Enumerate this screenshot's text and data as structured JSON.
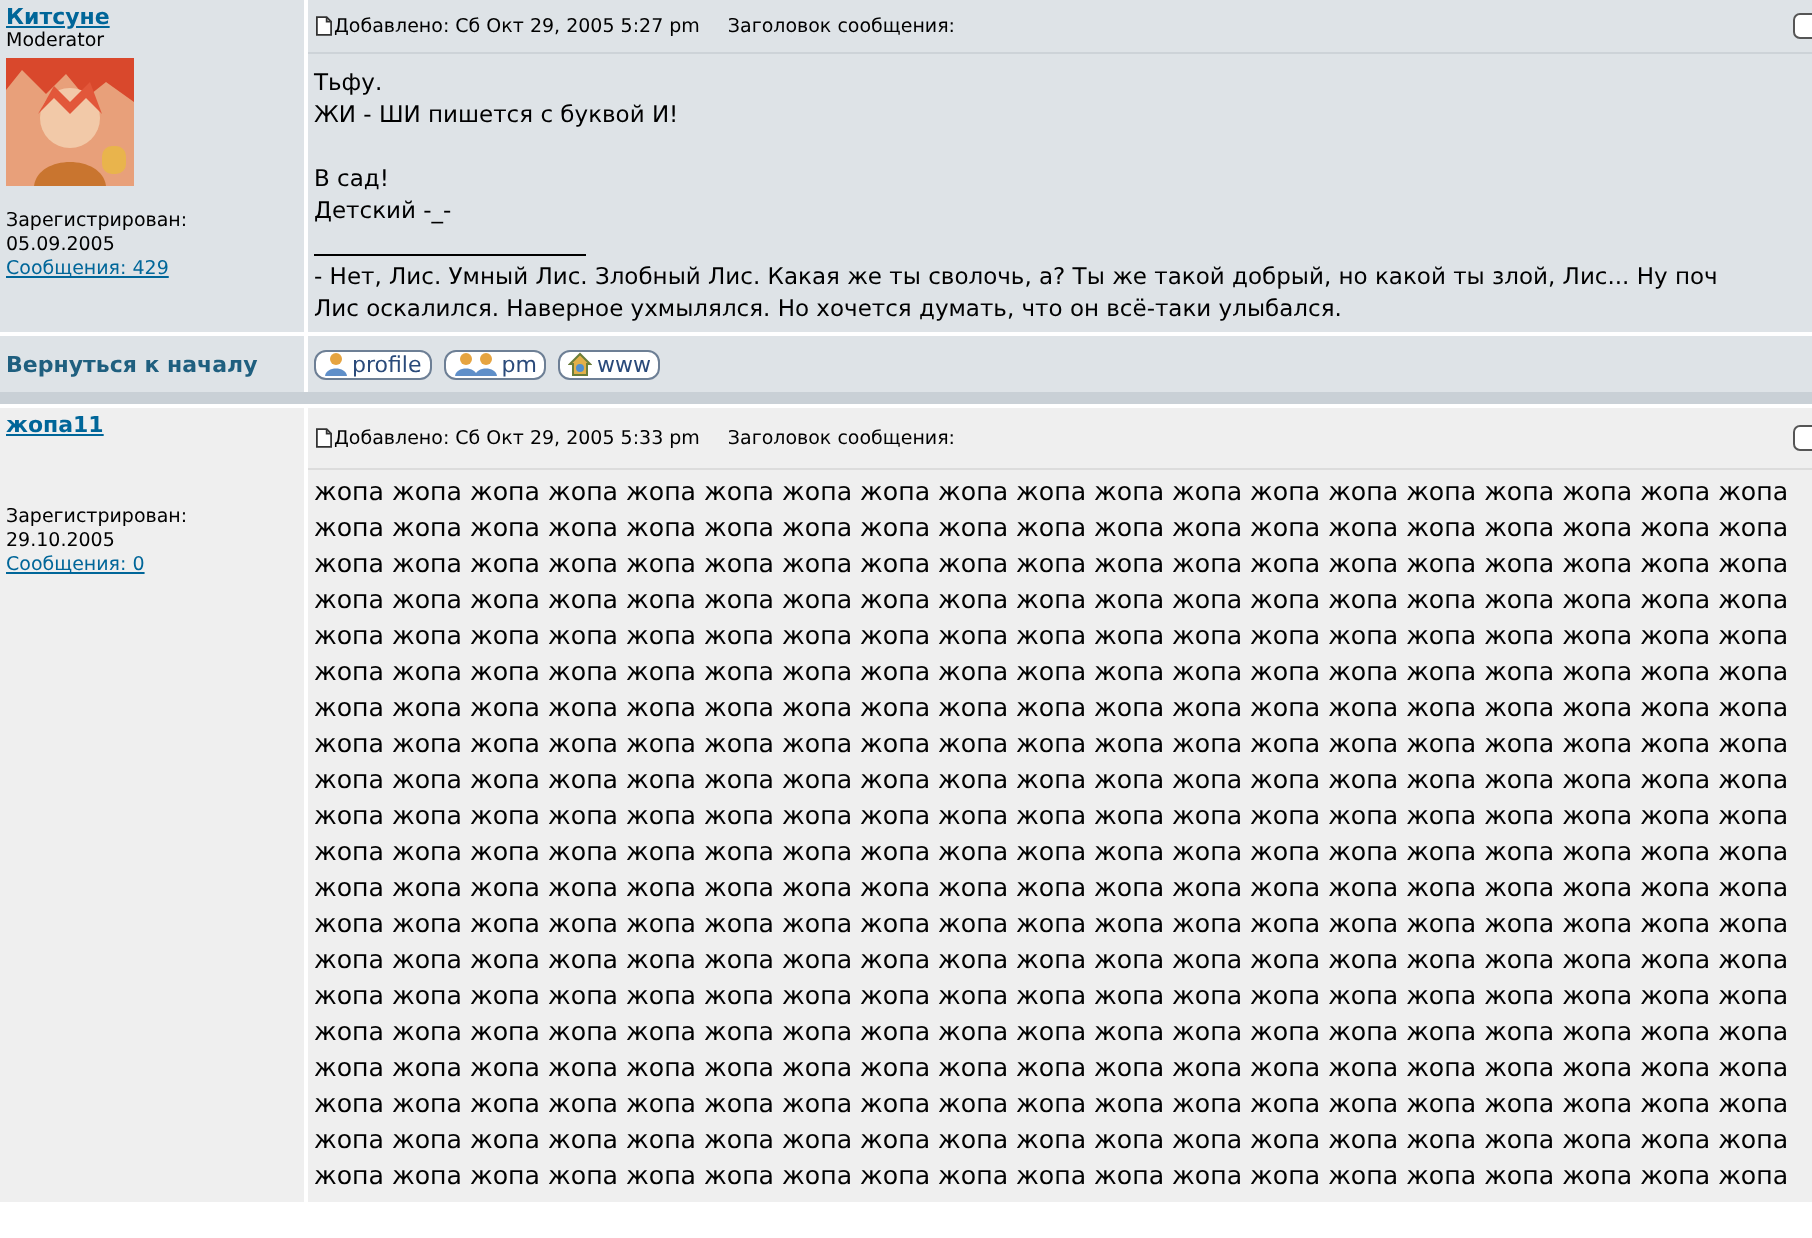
{
  "posts": [
    {
      "author": "Китсуне",
      "rank": "Moderator",
      "avatar": {
        "kind": "picture"
      },
      "registered_label": "Зарегистрирован:",
      "registered_date": "05.09.2005",
      "messages_link": "Сообщения: 429",
      "posted": "Добавлено: Сб Окт 29, 2005 5:27 pm",
      "subject_label": "Заголовок сообщения:",
      "paragraphs": [
        [
          "Тьфу.",
          "ЖИ - ШИ пишется с буквой И!"
        ],
        [
          "В сад!",
          "Детский -_-"
        ]
      ],
      "signature": [
        "- Нет, Лис. Умный Лис. Злобный Лис. Какая же ты сволочь, а? Ты же такой добрый, но какой ты злой, Лис... Ну поч",
        "Лис оскалился. Наверное ухмылялся. Но хочется думать, что он всё-таки улыбался."
      ],
      "back_link": "Вернуться к началу",
      "buttons": [
        {
          "label": "profile",
          "kind": "person"
        },
        {
          "label": "pm",
          "kind": "people"
        },
        {
          "label": "www",
          "kind": "home"
        }
      ]
    },
    {
      "author": "жопа11",
      "registered_label": "Зарегистрирован:",
      "registered_date": "29.10.2005",
      "messages_link": "Сообщения: 0",
      "posted": "Добавлено: Сб Окт 29, 2005 5:33 pm",
      "subject_label": "Заголовок сообщения:",
      "paragraphs": [
        [
          "жопа жопа жопа жопа жопа жопа жопа жопа жопа жопа жопа жопа жопа жопа жопа жопа жопа жопа жопа",
          "жопа жопа жопа жопа жопа жопа жопа жопа жопа жопа жопа жопа жопа жопа жопа жопа жопа жопа жопа",
          "жопа жопа жопа жопа жопа жопа жопа жопа жопа жопа жопа жопа жопа жопа жопа жопа жопа жопа жопа",
          "жопа жопа жопа жопа жопа жопа жопа жопа жопа жопа жопа жопа жопа жопа жопа жопа жопа жопа жопа",
          "жопа жопа жопа жопа жопа жопа жопа жопа жопа жопа жопа жопа жопа жопа жопа жопа жопа жопа жопа",
          "жопа жопа жопа жопа жопа жопа жопа жопа жопа жопа жопа жопа жопа жопа жопа жопа жопа жопа жопа",
          "жопа жопа жопа жопа жопа жопа жопа жопа жопа жопа жопа жопа жопа жопа жопа жопа жопа жопа жопа",
          "жопа жопа жопа жопа жопа жопа жопа жопа жопа жопа жопа жопа жопа жопа жопа жопа жопа жопа жопа",
          "жопа жопа жопа жопа жопа жопа жопа жопа жопа жопа жопа жопа жопа жопа жопа жопа жопа жопа жопа",
          "жопа жопа жопа жопа жопа жопа жопа жопа жопа жопа жопа жопа жопа жопа жопа жопа жопа жопа жопа",
          "жопа жопа жопа жопа жопа жопа жопа жопа жопа жопа жопа жопа жопа жопа жопа жопа жопа жопа жопа",
          "жопа жопа жопа жопа жопа жопа жопа жопа жопа жопа жопа жопа жопа жопа жопа жопа жопа жопа жопа",
          "жопа жопа жопа жопа жопа жопа жопа жопа жопа жопа жопа жопа жопа жопа жопа жопа жопа жопа жопа",
          "жопа жопа жопа жопа жопа жопа жопа жопа жопа жопа жопа жопа жопа жопа жопа жопа жопа жопа жопа",
          "жопа жопа жопа жопа жопа жопа жопа жопа жопа жопа жопа жопа жопа жопа жопа жопа жопа жопа жопа",
          "жопа жопа жопа жопа жопа жопа жопа жопа жопа жопа жопа жопа жопа жопа жопа жопа жопа жопа жопа",
          "жопа жопа жопа жопа жопа жопа жопа жопа жопа жопа жопа жопа жопа жопа жопа жопа жопа жопа жопа",
          "жопа жопа жопа жопа жопа жопа жопа жопа жопа жопа жопа жопа жопа жопа жопа жопа жопа жопа жопа",
          "жопа жопа жопа жопа жопа жопа жопа жопа жопа жопа жопа жопа жопа жопа жопа жопа жопа жопа жопа",
          "жопа жопа жопа жопа жопа жопа жопа жопа жопа жопа жопа жопа жопа жопа жопа жопа жопа жопа жопа"
        ]
      ]
    }
  ]
}
